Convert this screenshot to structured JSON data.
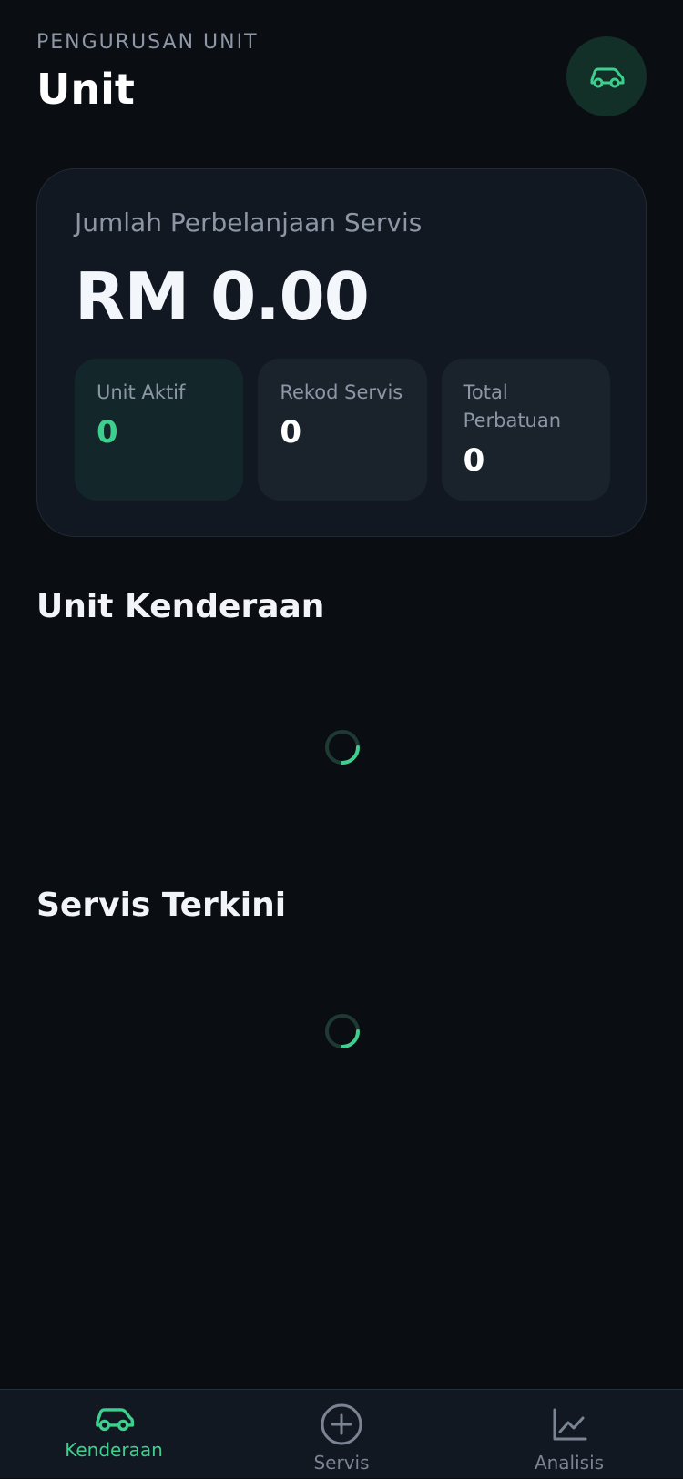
{
  "header": {
    "eyebrow": "PENGURUSAN UNIT",
    "title": "Unit",
    "icon": "car-icon"
  },
  "summary": {
    "label": "Jumlah Perbelanjaan Servis",
    "value": "RM 0.00",
    "stats": [
      {
        "label": "Unit Aktif",
        "value": "0"
      },
      {
        "label": "Rekod Servis",
        "value": "0"
      },
      {
        "label": "Total Perbatuan",
        "value": "0"
      }
    ]
  },
  "sections": {
    "vehicles_title": "Unit Kenderaan",
    "recent_services_title": "Servis Terkini"
  },
  "nav": [
    {
      "label": "Kenderaan",
      "icon": "car-icon",
      "active": true
    },
    {
      "label": "Servis",
      "icon": "plus-circle-icon",
      "active": false
    },
    {
      "label": "Analisis",
      "icon": "chart-icon",
      "active": false
    }
  ],
  "colors": {
    "accent": "#3ECF8E",
    "background": "#0A0D12",
    "card": "#111821"
  }
}
